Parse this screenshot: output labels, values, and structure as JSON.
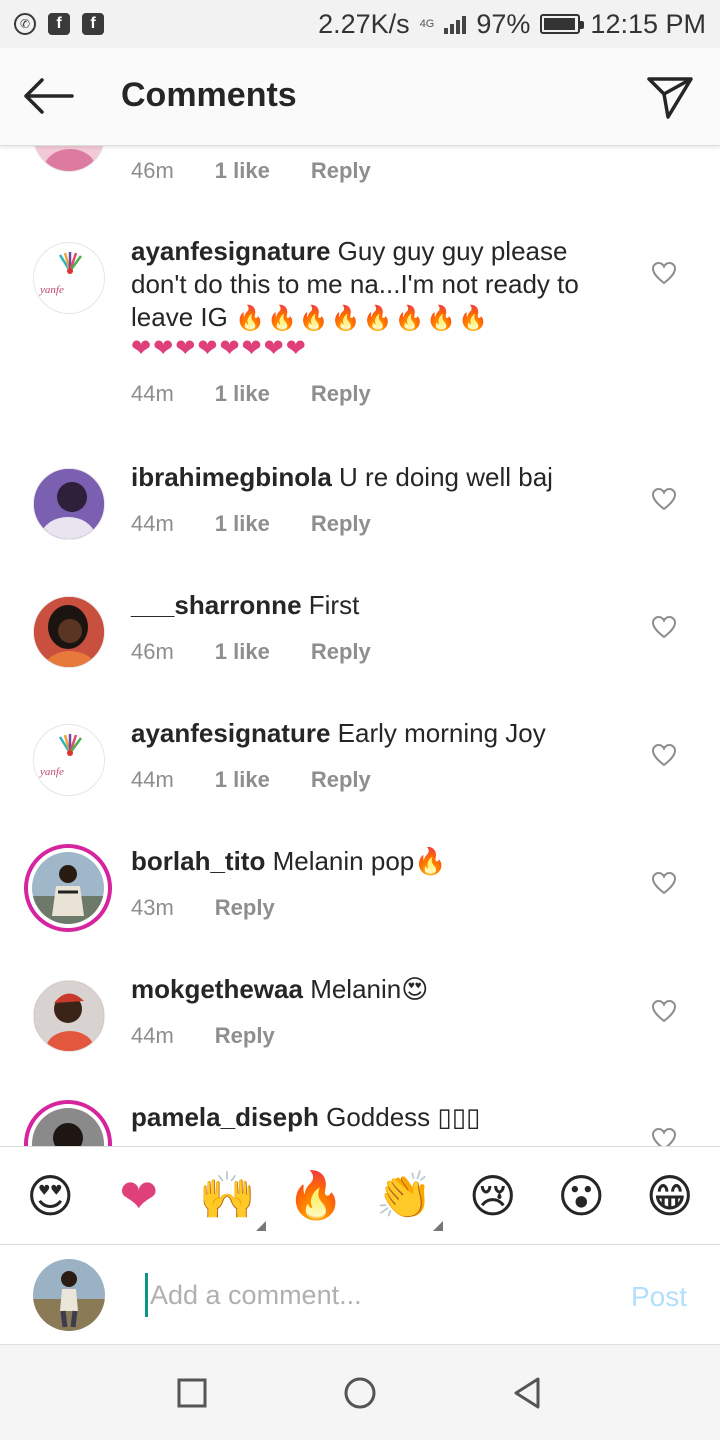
{
  "status_bar": {
    "speed": "2.27K/s",
    "network": "4G",
    "battery_percent": "97%",
    "battery_level": 0.97,
    "time": "12:15 PM"
  },
  "header": {
    "title": "Comments"
  },
  "comments": [
    {
      "username": "",
      "text": "",
      "time": "46m",
      "likes": "1 like",
      "reply": "Reply",
      "avatar": "pink-avatar"
    },
    {
      "username": "ayanfesignature",
      "text": "Guy guy guy please don't do this to me na...I'm not ready to leave IG",
      "emoji_line1": "🔥🔥🔥🔥🔥🔥🔥🔥",
      "emoji_line2": "❤❤❤❤❤❤❤❤",
      "time": "44m",
      "likes": "1 like",
      "reply": "Reply"
    },
    {
      "username": "ibrahimegbinola",
      "text": "U re doing well baj",
      "time": "44m",
      "likes": "1 like",
      "reply": "Reply"
    },
    {
      "username": "___sharronne",
      "text": "First",
      "time": "46m",
      "likes": "1 like",
      "reply": "Reply"
    },
    {
      "username": "ayanfesignature",
      "text": "Early morning Joy",
      "time": "44m",
      "likes": "1 like",
      "reply": "Reply"
    },
    {
      "username": "borlah_tito",
      "text": "Melanin pop🔥",
      "time": "43m",
      "reply": "Reply"
    },
    {
      "username": "mokgethewaa",
      "text": "Melanin😍",
      "time": "44m",
      "reply": "Reply"
    },
    {
      "username": "pamela_diseph",
      "text": "Goddess ▯▯▯"
    }
  ],
  "reactions": [
    "😍",
    "❤",
    "🙌",
    "🔥",
    "👏",
    "😢",
    "😮",
    "😁"
  ],
  "composer": {
    "placeholder": "Add a comment...",
    "post_label": "Post"
  },
  "colors": {
    "story_ring": "#d6249f",
    "post_disabled": "#b2dffc",
    "meta_gray": "#8e8e8e"
  }
}
